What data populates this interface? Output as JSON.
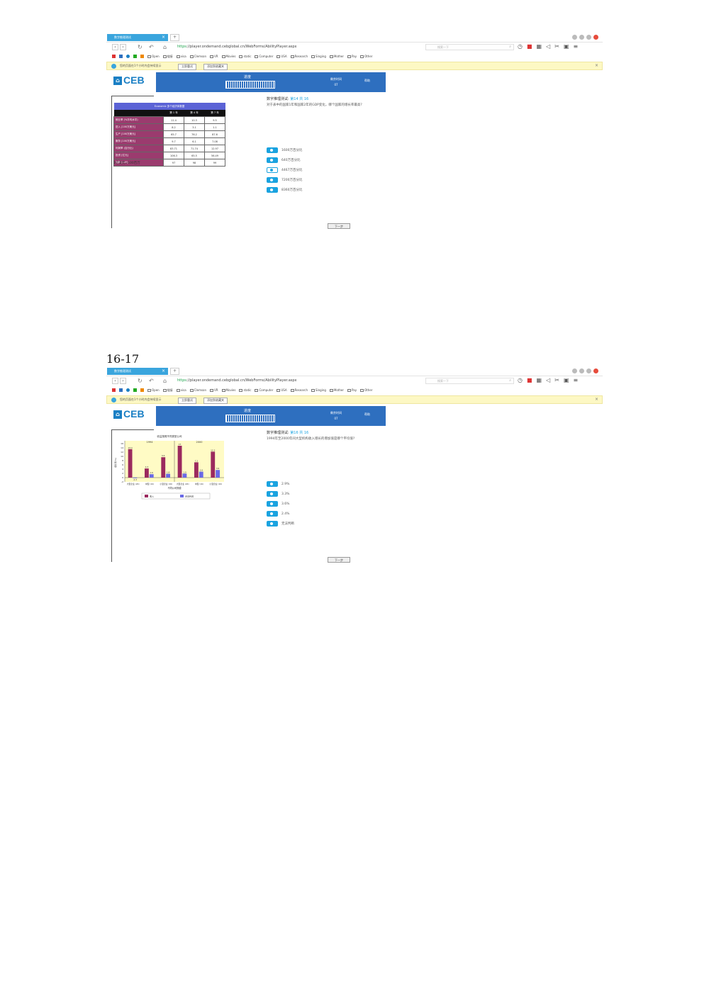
{
  "browser": {
    "tab_title": "数字推理测试",
    "tab_close": "×",
    "tab_new": "+",
    "url_secure": "https",
    "url_rest": "://player.ondemand.cebglobal.cn/WebForms/AbilityPlayer.aspx",
    "search_placeholder": "搜索一下",
    "bookmarks": [
      "Open",
      "链接",
      "visa",
      "Clemson",
      "VR",
      "Movies",
      "static",
      "Computer",
      "USA",
      "Research",
      "Singing",
      "Mother",
      "Pay",
      "Other"
    ],
    "notice_text": "您的页面在1个小时内会持续显示",
    "notice_btn1": "立即重试",
    "notice_btn2": "添加到收藏夹",
    "notice_close": "×"
  },
  "app": {
    "logo": "CEB",
    "progress_label": "进度",
    "time_label": "剩余时间",
    "time_value": "07",
    "help": "帮助",
    "next_button": "下一步"
  },
  "section_label": "16-17",
  "q1": {
    "prefix": "数字推理测试: ",
    "counter": "第14 共 16",
    "text": "对于表中的国家1年和国家2年的GDP变化，哪个国家的增长率最高?",
    "options": [
      "1600万百分比",
      "640万百分比",
      "4467万百分比",
      "7200万百分比",
      "8360万百分比"
    ],
    "selected": 2,
    "table": {
      "caption": "Economic 多个经济体数据",
      "columns": [
        "第 1 年",
        "第 4 年",
        "第 7 年"
      ],
      "rows": [
        {
          "label": "就业率 (%平均水平)",
          "values": [
            "11.4",
            "10.3",
            "9.5"
          ]
        },
        {
          "label": "进入 [100万美元]",
          "values": [
            "8.2",
            "3.1",
            "1.1"
          ]
        },
        {
          "label": "生产 [100万美元]",
          "values": [
            "65.7",
            "76.2",
            "87.6"
          ]
        },
        {
          "label": "服务 [100万美元]",
          "values": [
            "9.7",
            "6.1",
            "7.08"
          ]
        },
        {
          "label": "利润率 (百分比)",
          "values": [
            "83.71",
            "71.74",
            "12.97"
          ]
        },
        {
          "label": "投资 [亿元]",
          "values": [
            "106.3",
            "65.5",
            "56.49"
          ]
        },
        {
          "label": "指数 [100]",
          "values": [
            "97",
            "98",
            "99"
          ]
        }
      ],
      "note": "1亿美元=100百万"
    }
  },
  "q2": {
    "prefix": "数字推理测试: ",
    "counter": "第16 共 16",
    "text": "1994年至2000年间大型机构收入增长的增加值是哪个平均值?",
    "options": [
      "2.9%",
      "3.3%",
      "3.6%",
      "2.4%",
      "无法判断"
    ],
    "selected": -1
  },
  "chart_data": {
    "type": "bar",
    "title": "收益按照不同类型公司",
    "ylabel": "增长率(%)",
    "xlabel": "不同公司规模",
    "group_labels": [
      "1994",
      "2000"
    ],
    "categories": [
      "大型企业 (2K)",
      "中型 (1K)",
      "小型企业 (1K)",
      "大型企业 (2K)",
      "中型 (1K)",
      "小型企业 (1K)"
    ],
    "ylim": [
      -2,
      16
    ],
    "yticks": [
      -2,
      0,
      2,
      4,
      6,
      8,
      10,
      12,
      14,
      16
    ],
    "series": [
      {
        "name": "收入",
        "color": "#9b2a5e",
        "values": [
          13.4,
          4.3,
          9.6,
          15.0,
          7.2,
          12.2
        ]
      },
      {
        "name": "资本利润",
        "color": "#6a6ae6",
        "values": [
          -0.3,
          1.6,
          1.8,
          1.9,
          2.8,
          3.6
        ]
      }
    ],
    "background": "#fffbc5"
  }
}
